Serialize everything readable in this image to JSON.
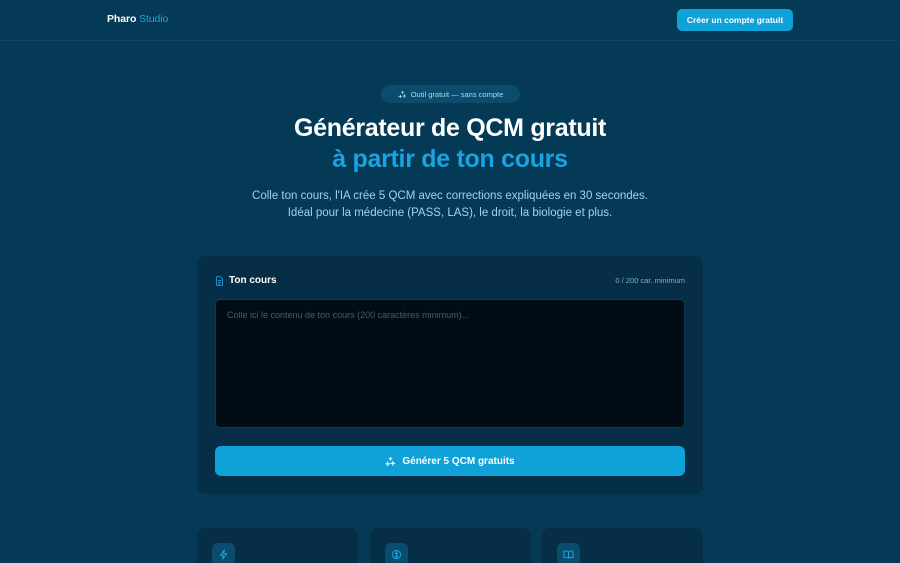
{
  "header": {
    "brand_primary": "Pharo",
    "brand_secondary": "Studio",
    "cta_label": "Créer un compte gratuit"
  },
  "hero": {
    "badge": "Outil gratuit — sans compte",
    "title_line1": "Générateur de QCM gratuit",
    "title_line2": "à partir de ton cours",
    "subtitle_line1": "Colle ton cours, l'IA crée 5 QCM avec corrections expliquées en 30 secondes.",
    "subtitle_line2": "Idéal pour la médecine (PASS, LAS), le droit, la biologie et plus."
  },
  "form": {
    "label": "Ton cours",
    "counter": "0 / 200 car. minimum",
    "value": "",
    "placeholder": "Colle ici le contenu de ton cours (200 caractères minimum)...",
    "submit_label": "Générer 5 QCM gratuits"
  },
  "features": [
    {
      "icon": "lightning-icon"
    },
    {
      "icon": "brain-icon"
    },
    {
      "icon": "book-icon"
    }
  ],
  "colors": {
    "background": "#053a57",
    "card": "#062e47",
    "accent": "#0ea2d9",
    "accent_text": "#1aa3de"
  }
}
